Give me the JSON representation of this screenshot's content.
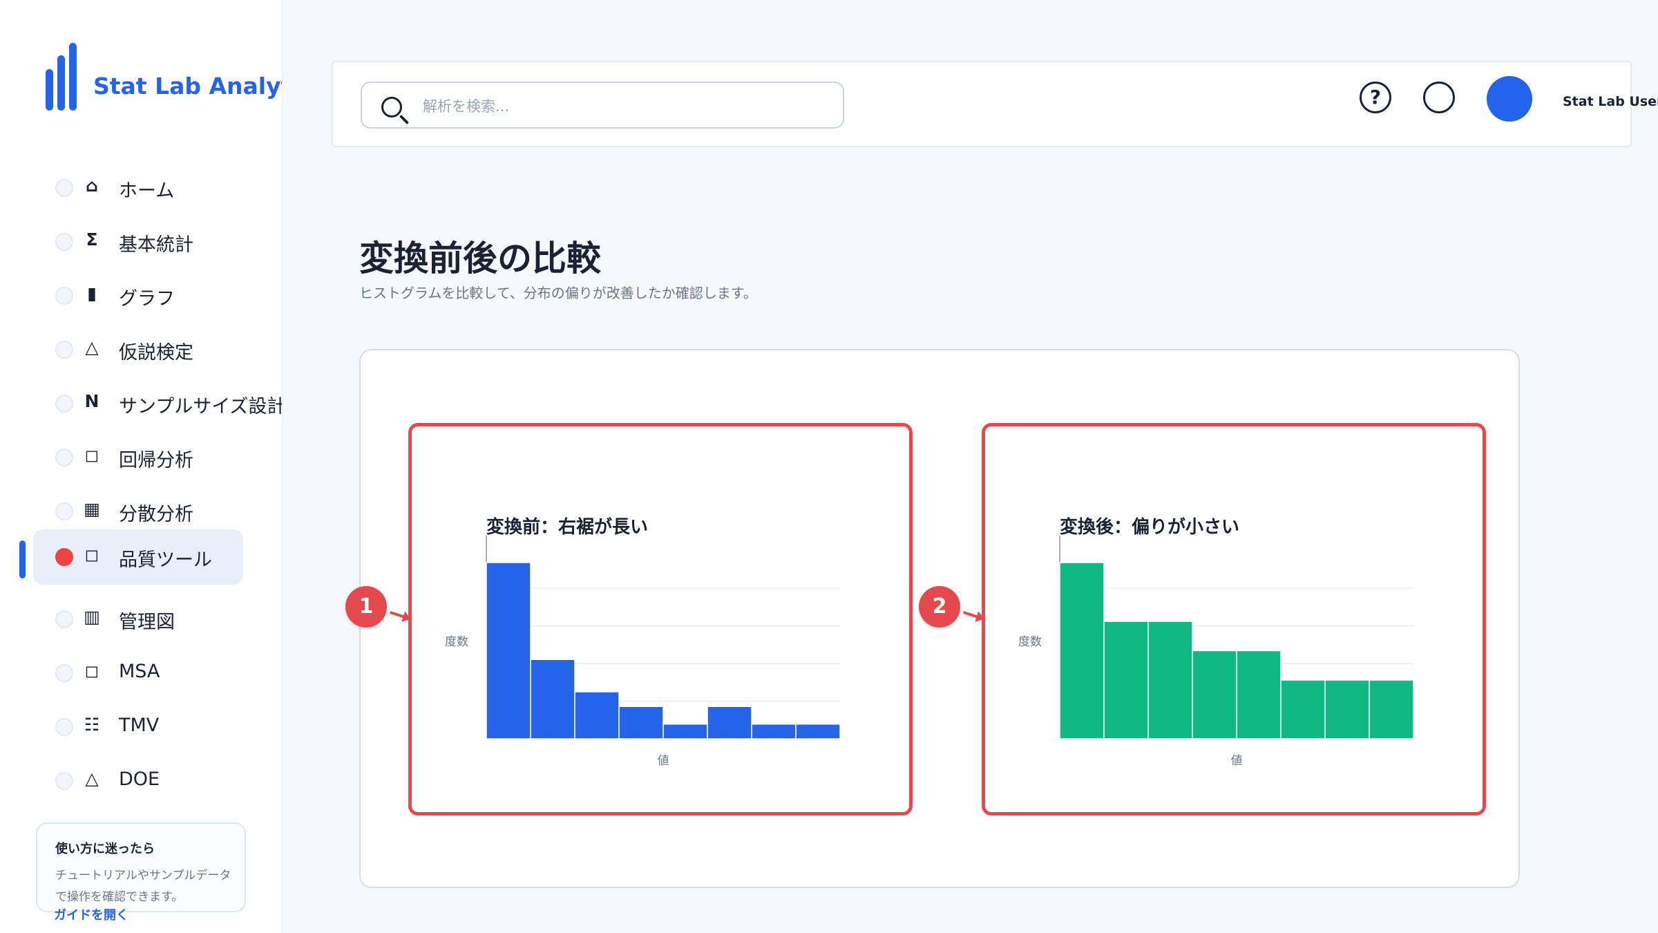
{
  "brand": {
    "name": "Stat Lab Analytics"
  },
  "sidebar": {
    "items": [
      {
        "icon": "⌂",
        "icon_name": "home-icon",
        "label": "ホーム"
      },
      {
        "icon": "Σ",
        "icon_name": "sigma-icon",
        "label": "基本統計"
      },
      {
        "icon": "▮",
        "icon_name": "bar-chart-icon",
        "label": "グラフ"
      },
      {
        "icon": "△",
        "icon_name": "triangle-icon",
        "label": "仮説検定"
      },
      {
        "icon": "N",
        "icon_name": "n-letter-icon",
        "label": "サンプルサイズ設計"
      },
      {
        "icon": "◻",
        "icon_name": "square-icon",
        "label": "回帰分析"
      },
      {
        "icon": "▦",
        "icon_name": "grid-icon",
        "label": "分散分析"
      },
      {
        "icon": "◻",
        "icon_name": "square-icon",
        "label": "品質ツール",
        "active": true
      },
      {
        "icon": "▥",
        "icon_name": "control-chart-icon",
        "label": "管理図"
      },
      {
        "icon": "◻",
        "icon_name": "square-icon",
        "label": "MSA"
      },
      {
        "icon": "☷",
        "icon_name": "list-icon",
        "label": "TMV"
      },
      {
        "icon": "△",
        "icon_name": "triangle-icon",
        "label": "DOE"
      },
      {
        "icon": "",
        "icon_name": "",
        "label": ""
      }
    ]
  },
  "help_card": {
    "title": "使い方に迷ったら",
    "text": "チュートリアルやサンプルデータで操作を確認できます。",
    "link": "ガイドを開く"
  },
  "header": {
    "search_placeholder": "解析を検索...",
    "help_symbol": "?",
    "user_name": "Stat Lab User"
  },
  "page": {
    "title": "変換前後の比較",
    "subtitle": "ヒストグラムを比較して、分布の偏りが改善したか確認します。"
  },
  "markers": [
    "1",
    "2"
  ],
  "colors": {
    "accent": "#2563eb",
    "marker": "#e5484d",
    "before": "#2563eb",
    "after": "#10b981"
  },
  "chart_data": [
    {
      "type": "bar",
      "title": "変換前：右裾が長い",
      "xlabel": "値",
      "ylabel": "度数",
      "values": [
        30,
        13.5,
        8,
        5.5,
        2.5,
        5.5,
        2.5,
        2.5
      ],
      "ylim": [
        0,
        32
      ],
      "grid": true,
      "color": "#2563eb"
    },
    {
      "type": "bar",
      "title": "変換後：偏りが小さい",
      "xlabel": "値",
      "ylabel": "度数",
      "values": [
        30,
        20,
        20,
        15,
        15,
        10,
        10,
        10
      ],
      "ylim": [
        0,
        32
      ],
      "grid": true,
      "color": "#10b981"
    }
  ]
}
